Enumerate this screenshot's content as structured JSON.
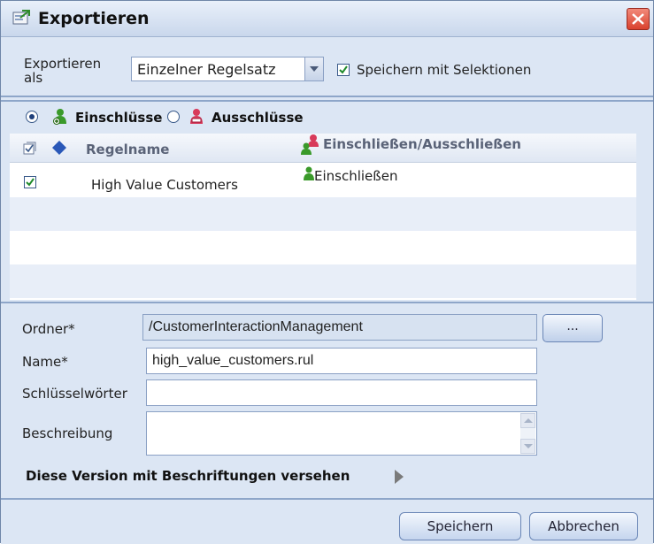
{
  "window": {
    "title": "Exportieren",
    "close_icon": "close-icon"
  },
  "export_as": {
    "label": "Exportieren als",
    "selected": "Einzelner Regelsatz",
    "save_with_selections": {
      "label": "Speichern mit Selektionen",
      "checked": true
    }
  },
  "rules": {
    "radio_include": {
      "label": "Einschlüsse",
      "selected": true
    },
    "radio_exclude": {
      "label": "Ausschlüsse",
      "selected": false
    },
    "columns": {
      "rule_name": "Regelname",
      "include_exclude": "Einschließen/Ausschließen"
    },
    "rows": [
      {
        "checked": true,
        "rule_name": "High Value Customers",
        "include_exclude": "Einschließen"
      }
    ]
  },
  "form": {
    "folder": {
      "label": "Ordner*",
      "value": "/CustomerInteractionManagement",
      "browse_label": "..."
    },
    "name": {
      "label": "Name*",
      "value": "high_value_customers.rul"
    },
    "keywords": {
      "label": "Schlüsselwörter",
      "value": ""
    },
    "description": {
      "label": "Beschreibung",
      "value": ""
    },
    "version_label": "Diese Version mit Beschriftungen versehen"
  },
  "footer": {
    "save_label": "Speichern",
    "cancel_label": "Abbrechen"
  },
  "colors": {
    "accent": "#1f3f7a",
    "panel": "#dce6f4",
    "include_icon": "#3a9a2a",
    "exclude_icon": "#d83a5a"
  }
}
